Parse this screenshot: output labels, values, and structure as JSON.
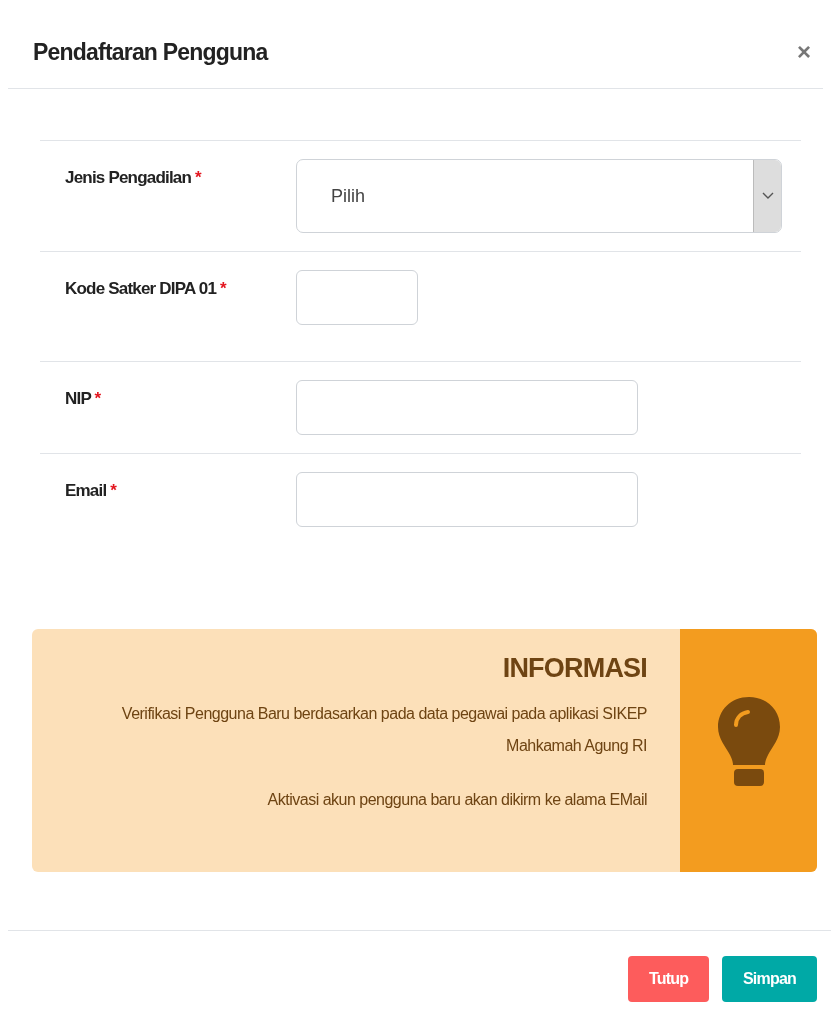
{
  "modal": {
    "title": "Pendaftaran Pengguna",
    "close": "×"
  },
  "fields": [
    {
      "kind": "select",
      "label": "Jenis Pengadilan",
      "required_mark": "*",
      "value": "Pilih"
    },
    {
      "kind": "short",
      "label": "Kode Satker DIPA 01",
      "required_mark": "*"
    },
    {
      "kind": "text",
      "label": "NIP",
      "required_mark": "*"
    },
    {
      "kind": "text",
      "label": "Email",
      "required_mark": "*"
    }
  ],
  "info": {
    "title": "INFORMASI",
    "lines": [
      "Verifikasi Pengguna Baru berdasarkan pada data pegawai pada aplikasi SIKEP Mahkamah Agung RI",
      "Aktivasi akun pengguna baru akan dikirm ke alama EMail"
    ]
  },
  "buttons": [
    {
      "kind": "danger",
      "label": "Tutup"
    },
    {
      "kind": "primary",
      "label": "Simpan"
    }
  ]
}
